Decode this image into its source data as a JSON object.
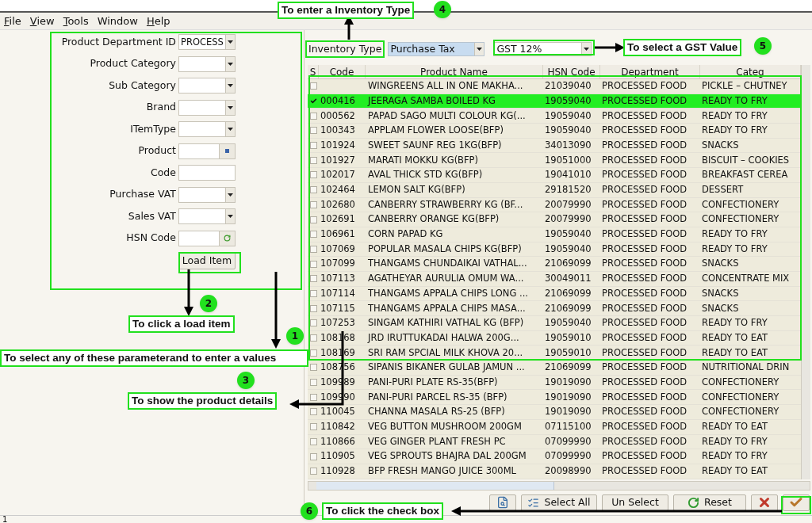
{
  "menu": [
    {
      "label": "File",
      "mnemonic": true
    },
    {
      "label": "View",
      "mnemonic": true
    },
    {
      "label": "Tools",
      "mnemonic": true
    },
    {
      "label": "Window",
      "mnemonic": false
    },
    {
      "label": "Help",
      "mnemonic": true
    }
  ],
  "form": {
    "fields": [
      {
        "label": "Product Department ID",
        "kind": "dropdown",
        "value": "PROCESS"
      },
      {
        "label": "Product Category",
        "kind": "dropdown"
      },
      {
        "label": "Sub Category",
        "kind": "dropdown"
      },
      {
        "label": "Brand",
        "kind": "dropdown"
      },
      {
        "label": "ITemType",
        "kind": "dropdown"
      },
      {
        "label": "Product",
        "kind": "lookup"
      },
      {
        "label": "Code",
        "kind": "text"
      },
      {
        "label": "Purchase VAT",
        "kind": "dropdown"
      },
      {
        "label": "Sales VAT",
        "kind": "dropdown"
      },
      {
        "label": "HSN Code",
        "kind": "refresh"
      }
    ],
    "button": "Load Item"
  },
  "toolbar": {
    "label": "Inventory Type",
    "inventory_type": "Purchase Tax",
    "gst": "GST 12%"
  },
  "table": {
    "columns": [
      "S",
      "Code",
      "Product Name",
      "HSN Code",
      "Department",
      "Categ"
    ],
    "rows": [
      {
        "checked": false,
        "selected": false,
        "code": "",
        "name": "WINGREENS ALL IN ONE MAKHA...",
        "hsn": "21039040",
        "department": "PROCESSED FOOD",
        "category": "PICKLE – CHUTNEY"
      },
      {
        "checked": true,
        "selected": true,
        "code": "000416",
        "name": "JEERAGA SAMBA BOILED KG",
        "hsn": "19059040",
        "department": "PROCESSED FOOD",
        "category": "READY TO FRY"
      },
      {
        "checked": false,
        "selected": false,
        "code": "000562",
        "name": "PAPAD SAGO MULTI COLOUR KG(...",
        "hsn": "19059040",
        "department": "PROCESSED FOOD",
        "category": "READY TO FRY"
      },
      {
        "checked": false,
        "selected": false,
        "code": "100343",
        "name": "APPLAM FLOWER LOOSE(BFP)",
        "hsn": "19059040",
        "department": "PROCESSED FOOD",
        "category": "READY TO FRY"
      },
      {
        "checked": false,
        "selected": false,
        "code": "101924",
        "name": "SWEET SAUNF REG 1KG(BFP)",
        "hsn": "34013090",
        "department": "PROCESSED FOOD",
        "category": "SNACKS"
      },
      {
        "checked": false,
        "selected": false,
        "code": "101927",
        "name": "MARATI MOKKU KG(BFP)",
        "hsn": "19051000",
        "department": "PROCESSED FOOD",
        "category": "BISCUIT – COOKIES"
      },
      {
        "checked": false,
        "selected": false,
        "code": "102017",
        "name": "AVAL THICK STD KG(BFP)",
        "hsn": "19041010",
        "department": "PROCESSED FOOD",
        "category": "BREAKFAST CEREA"
      },
      {
        "checked": false,
        "selected": false,
        "code": "102464",
        "name": "LEMON SALT KG(BFP)",
        "hsn": "29181520",
        "department": "PROCESSED FOOD",
        "category": "DESSERT"
      },
      {
        "checked": false,
        "selected": false,
        "code": "102680",
        "name": "CANBERRY STRAWBERRY KG (BF...",
        "hsn": "20079990",
        "department": "PROCESSED FOOD",
        "category": "CONFECTIONERY"
      },
      {
        "checked": false,
        "selected": false,
        "code": "102691",
        "name": "CANBERRY ORANGE KG(BFP)",
        "hsn": "20079990",
        "department": "PROCESSED FOOD",
        "category": "CONFECTIONERY"
      },
      {
        "checked": false,
        "selected": false,
        "code": "106961",
        "name": "CORN  PAPAD KG",
        "hsn": "19059040",
        "department": "PROCESSED FOOD",
        "category": "READY TO FRY"
      },
      {
        "checked": false,
        "selected": false,
        "code": "107069",
        "name": "POPULAR MASALA CHIPS KG(BFP)",
        "hsn": "19059040",
        "department": "PROCESSED FOOD",
        "category": "READY TO FRY"
      },
      {
        "checked": false,
        "selected": false,
        "code": "107099",
        "name": "THANGAMS CHUNDAIKAI VATHAL...",
        "hsn": "21069099",
        "department": "PROCESSED FOOD",
        "category": "SNACKS"
      },
      {
        "checked": false,
        "selected": false,
        "code": "107113",
        "name": "AGATHEYAR AURULIA  OMUM WA...",
        "hsn": "30049011",
        "department": "PROCESSED FOOD",
        "category": "CONCENTRATE MIX"
      },
      {
        "checked": false,
        "selected": false,
        "code": "107114",
        "name": "THANGAMS APPALA CHIPS LONG ...",
        "hsn": "21069099",
        "department": "PROCESSED FOOD",
        "category": "SNACKS"
      },
      {
        "checked": false,
        "selected": false,
        "code": "107115",
        "name": "THANGAMS APPALA CHIPS MASA...",
        "hsn": "21069099",
        "department": "PROCESSED FOOD",
        "category": "SNACKS"
      },
      {
        "checked": false,
        "selected": false,
        "code": "107253",
        "name": "SINGAM KATHIRI VATHAL KG (BFP)",
        "hsn": "19059040",
        "department": "PROCESSED FOOD",
        "category": "READY TO FRY"
      },
      {
        "checked": false,
        "selected": false,
        "code": "108168",
        "name": "JRD IRUTTUKADAI HALWA 200G...",
        "hsn": "19059010",
        "department": "PROCESSED FOOD",
        "category": "READY TO EAT"
      },
      {
        "checked": false,
        "selected": false,
        "code": "108169",
        "name": "SRI RAM SPCIAL MILK KHOVA 20...",
        "hsn": "19059010",
        "department": "PROCESSED FOOD",
        "category": "READY TO EAT"
      },
      {
        "checked": false,
        "selected": false,
        "code": "108756",
        "name": "SIPANIS BIKANER GULAB JAMUN ...",
        "hsn": "21069099",
        "department": "PROCESSED FOOD",
        "category": "NUTRITIONAL DRIN"
      },
      {
        "checked": false,
        "selected": false,
        "code": "109989",
        "name": "PANI-PURI PLATE RS-35(BFP)",
        "hsn": "19019090",
        "department": "PROCESSED FOOD",
        "category": "CONFECTIONERY"
      },
      {
        "checked": false,
        "selected": false,
        "code": "109990",
        "name": "PANI-PURI PARCEL RS-35 (BFP)",
        "hsn": "19019090",
        "department": "PROCESSED FOOD",
        "category": "CONFECTIONERY"
      },
      {
        "checked": false,
        "selected": false,
        "code": "110045",
        "name": "CHANNA MASALA RS-25 (BFP)",
        "hsn": "19019090",
        "department": "PROCESSED FOOD",
        "category": "CONFECTIONERY"
      },
      {
        "checked": false,
        "selected": false,
        "code": "110842",
        "name": "VEG  BUTTON MUSHROOM 200GM",
        "hsn": "07115100",
        "department": "PROCESSED FOOD",
        "category": "READY TO EAT"
      },
      {
        "checked": false,
        "selected": false,
        "code": "110866",
        "name": "VEG GINGER PLANT FRESH PC",
        "hsn": "07099990",
        "department": "PROCESSED FOOD",
        "category": "READY TO FRY"
      },
      {
        "checked": false,
        "selected": false,
        "code": "110905",
        "name": "VEG SPROUTS BHAJRA DAL 200GM",
        "hsn": "07099990",
        "department": "PROCESSED FOOD",
        "category": "READY TO FRY"
      },
      {
        "checked": false,
        "selected": false,
        "code": "110928",
        "name": "BFP FRESH MANGO JUICE 300ML",
        "hsn": "20098990",
        "department": "PROCESSED FOOD",
        "category": "READY TO EAT"
      }
    ]
  },
  "buttons": [
    {
      "kind": "preview"
    },
    {
      "kind": "select_all",
      "label": "Select All"
    },
    {
      "kind": "unselect",
      "label": "Un Select"
    },
    {
      "kind": "reset",
      "label": "Reset"
    },
    {
      "kind": "cancel"
    },
    {
      "kind": "confirm"
    }
  ],
  "annotations": [
    {
      "number": "4",
      "text": "To  enter a Inventory Type"
    },
    {
      "number": "5",
      "text": "To select a GST Value"
    },
    {
      "number": "2",
      "text": "To click a load item"
    },
    {
      "number": "1",
      "text": "To select any of these parameterand to enter a values"
    },
    {
      "number": "3",
      "text": "To show the product details"
    },
    {
      "number": "6",
      "text": "To click the check box"
    }
  ],
  "status_bar": "1"
}
